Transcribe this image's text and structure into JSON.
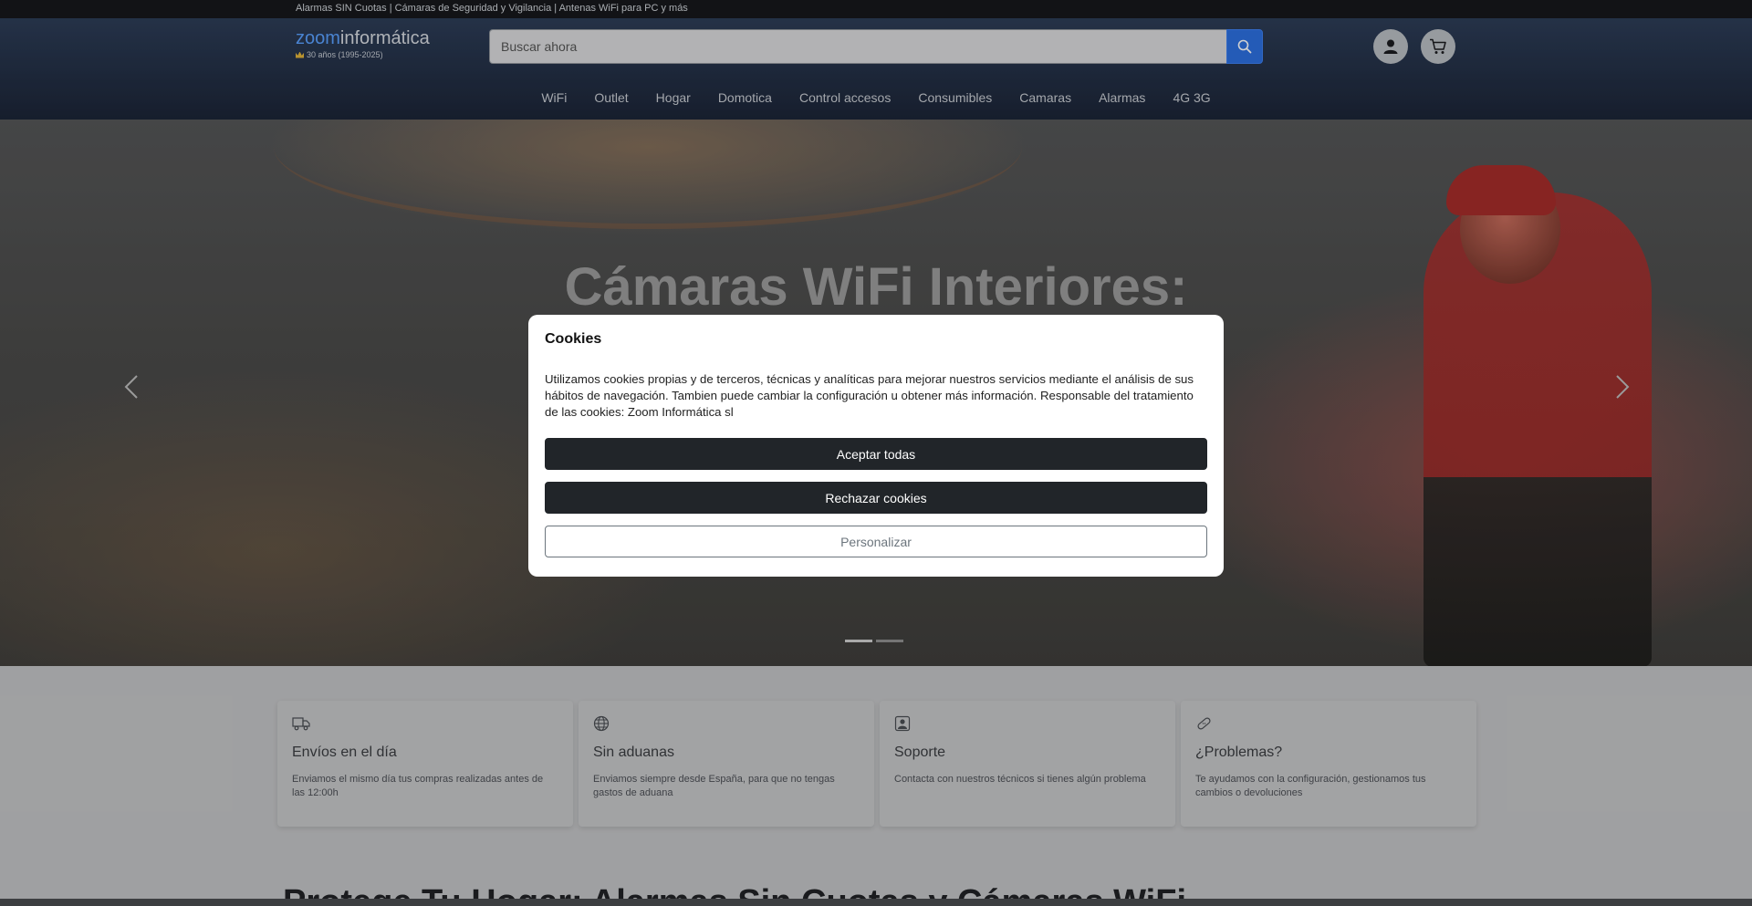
{
  "topbar": {
    "text": "Alarmas SIN Cuotas | Cámaras de Seguridad y Vigilancia | Antenas WiFi para PC y más"
  },
  "header": {
    "logo_zoom": "zoom",
    "logo_rest": "informática",
    "logo_sub": "30 años (1995-2025)",
    "search_placeholder": "Buscar ahora"
  },
  "nav": {
    "items": [
      "WiFi",
      "Outlet",
      "Hogar",
      "Domotica",
      "Control accesos",
      "Consumibles",
      "Camaras",
      "Alarmas",
      "4G 3G"
    ]
  },
  "hero": {
    "title": "Cámaras WiFi Interiores:"
  },
  "features": [
    {
      "title": "Envíos en el día",
      "desc": "Enviamos el mismo día tus compras realizadas antes de las 12:00h",
      "icon": "truck-icon"
    },
    {
      "title": "Sin aduanas",
      "desc": "Enviamos siempre desde España, para que no tengas gastos de aduana",
      "icon": "globe-icon"
    },
    {
      "title": "Soporte",
      "desc": "Contacta con nuestros técnicos si tienes algún problema",
      "icon": "support-icon"
    },
    {
      "title": "¿Problemas?",
      "desc": "Te ayudamos con la configuración, gestionamos tus cambios o devoluciones",
      "icon": "bandage-icon"
    }
  ],
  "bottom_heading": "Protege Tu Hogar: Alarmas Sin Cuotas y Cámaras WiFi",
  "cookie_modal": {
    "title": "Cookies",
    "text": "Utilizamos cookies propias y de terceros, técnicas y analíticas para mejorar nuestros servicios mediante el análisis de sus hábitos de navegación. Tambien puede cambiar la configuración u obtener más información. Responsable del tratamiento de las cookies: Zoom Informática sl",
    "accept_label": "Aceptar todas",
    "reject_label": "Rechazar cookies",
    "customize_label": "Personalizar"
  },
  "colors": {
    "header_bg": "#253249",
    "search_button": "#2c6fe0",
    "logo_accent": "#5aa0ff",
    "modal_button": "#212529"
  }
}
